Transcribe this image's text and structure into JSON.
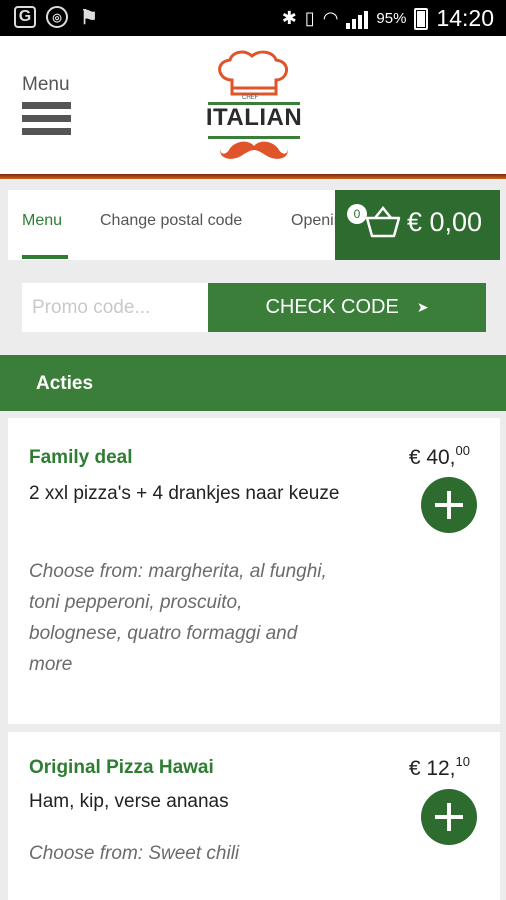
{
  "status_bar": {
    "battery": "95%",
    "time": "14:20"
  },
  "header": {
    "menu_label": "Menu",
    "logo_small": "CHEF",
    "logo_text": "ITALIAN"
  },
  "tabs": [
    {
      "label": "Menu",
      "active": true
    },
    {
      "label": "Change postal code",
      "active": false
    },
    {
      "label": "Openingstijden",
      "active": false
    }
  ],
  "cart": {
    "count": "0",
    "total": "€ 0,00"
  },
  "promo": {
    "placeholder": "Promo code...",
    "button_label": "CHECK CODE"
  },
  "section": {
    "title": "Acties"
  },
  "products": [
    {
      "title": "Family deal",
      "description": "2 xxl pizza's + 4 drankjes naar keuze",
      "choose": "Choose from: margherita, al funghi, toni pepperoni, proscuito, bolognese, quatro formaggi and more",
      "price_main": "€ 40,",
      "price_cents": "00"
    },
    {
      "title": "Original Pizza Hawai",
      "description": "Ham, kip, verse ananas",
      "choose": "Choose from: Sweet chili",
      "price_main": "€ 12,",
      "price_cents": "10"
    }
  ],
  "colors": {
    "brand_green": "#3a7e3a",
    "dark_green": "#2e6b2e",
    "logo_red": "#e0542a"
  },
  "icons": [
    "g-icon",
    "sync-icon",
    "flag-icon",
    "bluetooth-icon",
    "vibrate-icon",
    "wifi-icon",
    "signal-icon",
    "battery-icon",
    "hamburger-icon",
    "chef-hat-icon",
    "mustache-icon",
    "basket-icon",
    "arrow-right-icon",
    "plus-icon"
  ]
}
